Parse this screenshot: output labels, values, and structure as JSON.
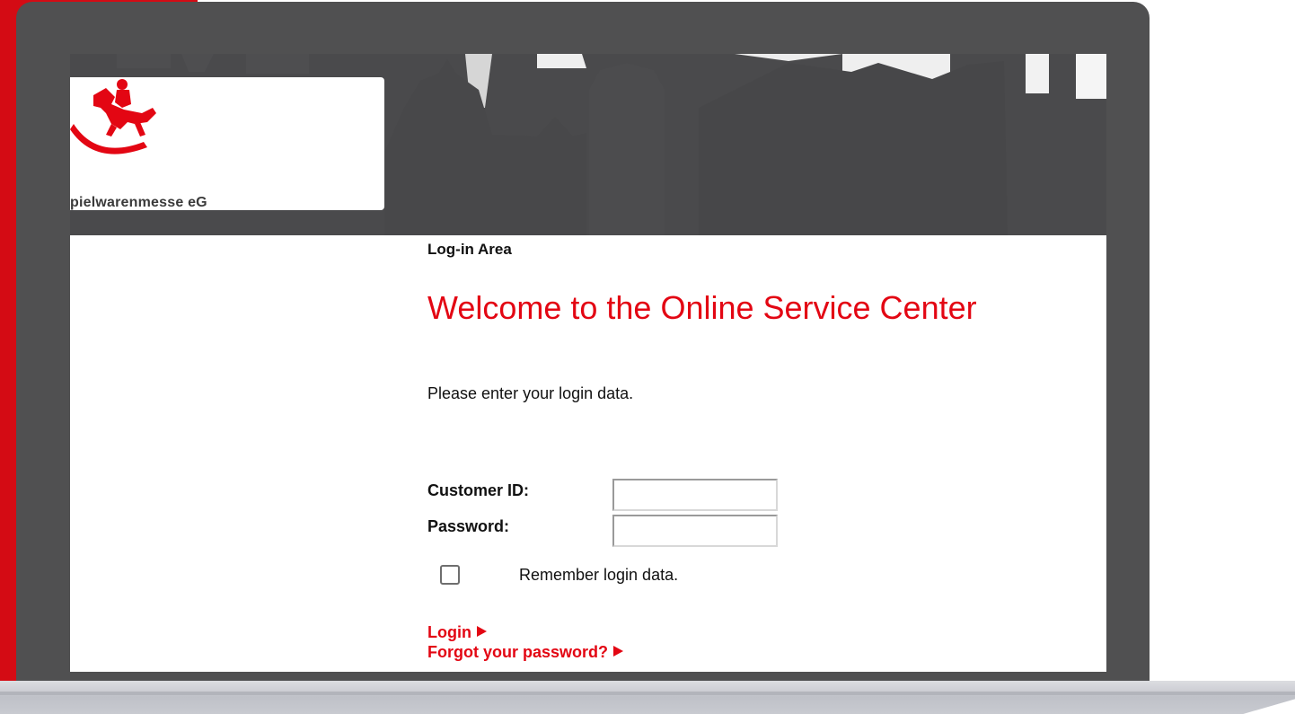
{
  "header": {
    "logo_text": "pielwarenmesse eG",
    "logo_icon": "rocking-horse-icon"
  },
  "main": {
    "section_label": "Log-in Area",
    "welcome_title": "Welcome to the Online Service Center",
    "intro_text": "Please enter your login data."
  },
  "form": {
    "customer_id_label": "Customer ID:",
    "customer_id_value": "",
    "password_label": "Password:",
    "password_value": "",
    "remember_label": "Remember login data.",
    "remember_checked": false,
    "login_link": "Login",
    "forgot_link": "Forgot your password?"
  },
  "colors": {
    "accent": "#e30613",
    "banner": "#4a4a4c",
    "frame": "#505051",
    "strip": "#d40b14"
  }
}
